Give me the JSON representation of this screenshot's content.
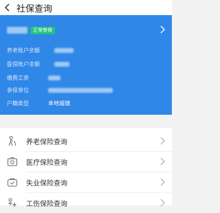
{
  "header": {
    "title": "社保查询",
    "back_icon": "back-arrow-icon"
  },
  "card": {
    "status_badge": "正常参保",
    "accent": "#2f87e8",
    "badge_color": "#20c37a",
    "rows": [
      {
        "label": "养老账户余额",
        "value": ""
      },
      {
        "label": "医保账户余额",
        "value": ""
      },
      {
        "label": "缴费工资",
        "value": ""
      },
      {
        "label": "参保单位",
        "value": ""
      },
      {
        "label": "户籍类型",
        "value": "本地城镇"
      }
    ]
  },
  "menu": {
    "items": [
      {
        "label": "养老保险查询",
        "icon": "elderly-person-icon"
      },
      {
        "label": "医疗保险查询",
        "icon": "medical-kit-icon"
      },
      {
        "label": "失业保险查询",
        "icon": "briefcase-icon"
      },
      {
        "label": "工伤保险查询",
        "icon": "injury-icon"
      }
    ]
  }
}
